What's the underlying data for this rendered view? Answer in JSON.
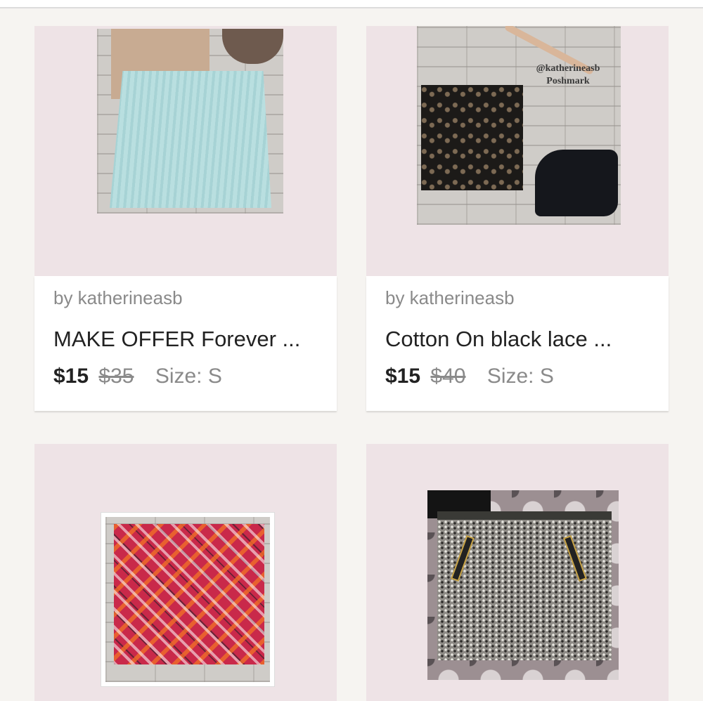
{
  "listings": [
    {
      "seller": "by katherineasb",
      "title": "MAKE OFFER Forever ...",
      "price": "$15",
      "original_price": "$35",
      "size": "Size: S"
    },
    {
      "seller": "by katherineasb",
      "title": "Cotton On black lace ...",
      "price": "$15",
      "original_price": "$40",
      "size": "Size: S",
      "watermark": "@katherineasb Poshmark"
    },
    {},
    {}
  ],
  "colors": {
    "card_background": "#eee3e6",
    "page_background": "#f6f4f1"
  }
}
